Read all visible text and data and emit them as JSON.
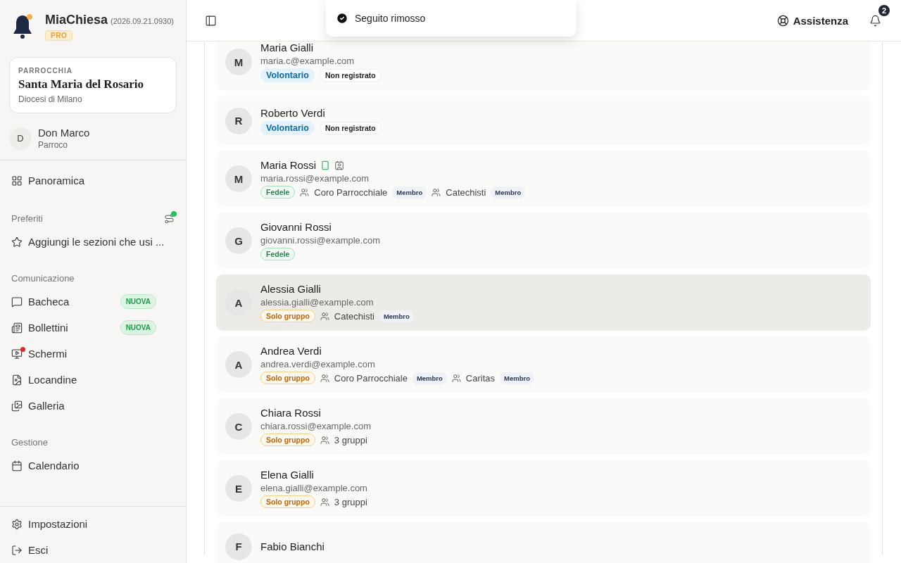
{
  "brand": {
    "name": "MiaChiesa",
    "version": "(2026.09.21.0930)",
    "plan": "PRO"
  },
  "parish": {
    "label": "PARROCCHIA",
    "name": "Santa Maria del Rosario",
    "diocese": "Diocesi di Milano"
  },
  "user": {
    "initial": "D",
    "name": "Don Marco",
    "role": "Parroco"
  },
  "overview": {
    "label": "Panoramica"
  },
  "favorites": {
    "title": "Preferiti",
    "hint": "Aggiungi le sezioni che usi ...",
    "alert": true
  },
  "sections": [
    {
      "title": "Comunicazione",
      "items": [
        {
          "label": "Bacheca",
          "badge": "NUOVA",
          "alert": false
        },
        {
          "label": "Bollettini",
          "badge": "NUOVA",
          "alert": false
        },
        {
          "label": "Schermi",
          "alert": true
        },
        {
          "label": "Locandine",
          "alert": false
        },
        {
          "label": "Galleria",
          "alert": false
        }
      ]
    },
    {
      "title": "Gestione",
      "items": [
        {
          "label": "Calendario",
          "alert": false
        }
      ]
    }
  ],
  "footer_items": [
    {
      "label": "Impostazioni"
    },
    {
      "label": "Esci"
    }
  ],
  "toast": {
    "message": "Seguito rimosso"
  },
  "header": {
    "help": "Assistenza",
    "notifications": "2"
  },
  "people": [
    {
      "initial": "M",
      "name": "Maria Gialli",
      "email": "maria.c@example.com",
      "highlighted": false,
      "tags": [
        {
          "kind": "volunteer",
          "label": "Volontario"
        },
        {
          "kind": "plain",
          "label": "Non registrato"
        }
      ]
    },
    {
      "initial": "R",
      "name": "Roberto Verdi",
      "highlighted": false,
      "tags": [
        {
          "kind": "volunteer",
          "label": "Volontario"
        },
        {
          "kind": "plain",
          "label": "Non registrato"
        }
      ]
    },
    {
      "initial": "M",
      "name": "Maria Rossi",
      "email": "maria.rossi@example.com",
      "app": true,
      "contact": true,
      "highlighted": false,
      "tags": [
        {
          "kind": "faithful",
          "label": "Fedele"
        }
      ],
      "groups": [
        {
          "name": "Coro Parrocchiale",
          "role": "Membro"
        },
        {
          "name": "Catechisti",
          "role": "Membro"
        }
      ]
    },
    {
      "initial": "G",
      "name": "Giovanni Rossi",
      "email": "giovanni.rossi@example.com",
      "highlighted": false,
      "tags": [
        {
          "kind": "faithful",
          "label": "Fedele"
        }
      ]
    },
    {
      "initial": "A",
      "name": "Alessia Gialli",
      "email": "alessia.gialli@example.com",
      "highlighted": true,
      "tags": [
        {
          "kind": "group",
          "label": "Solo gruppo"
        }
      ],
      "groups": [
        {
          "name": "Catechisti",
          "role": "Membro"
        }
      ]
    },
    {
      "initial": "A",
      "name": "Andrea Verdi",
      "email": "andrea.verdi@example.com",
      "highlighted": false,
      "tags": [
        {
          "kind": "group",
          "label": "Solo gruppo"
        }
      ],
      "groups": [
        {
          "name": "Coro Parrocchiale",
          "role": "Membro"
        },
        {
          "name": "Caritas",
          "role": "Membro"
        }
      ]
    },
    {
      "initial": "C",
      "name": "Chiara Rossi",
      "email": "chiara.rossi@example.com",
      "highlighted": false,
      "tags": [
        {
          "kind": "group",
          "label": "Solo gruppo"
        }
      ],
      "groups": [
        {
          "name": "3 gruppi"
        }
      ]
    },
    {
      "initial": "E",
      "name": "Elena Gialli",
      "email": "elena.gialli@example.com",
      "highlighted": false,
      "tags": [
        {
          "kind": "group",
          "label": "Solo gruppo"
        }
      ],
      "groups": [
        {
          "name": "3 gruppi"
        }
      ]
    },
    {
      "initial": "F",
      "name": "Fabio Bianchi",
      "highlighted": false
    }
  ]
}
